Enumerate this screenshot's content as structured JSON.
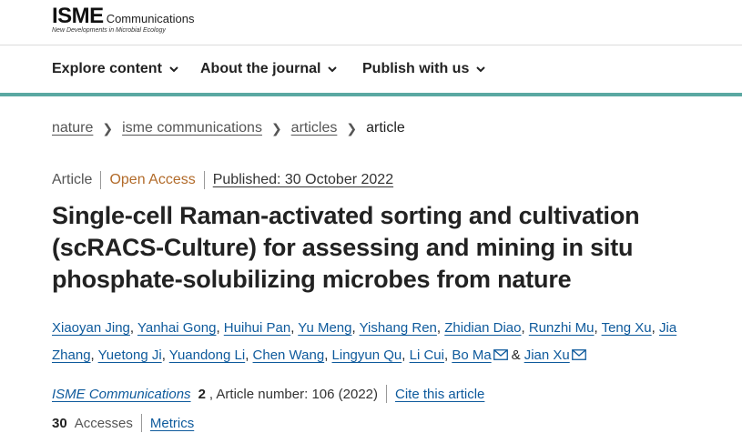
{
  "header": {
    "logo_main": "ISME",
    "logo_sub": "Communications",
    "logo_tagline": "New Developments in Microbial Ecology"
  },
  "nav": {
    "items": [
      {
        "label": "Explore content"
      },
      {
        "label": "About the journal"
      },
      {
        "label": "Publish with us"
      }
    ]
  },
  "breadcrumb": {
    "items": [
      "nature",
      "isme communications",
      "articles"
    ],
    "current": "article"
  },
  "meta": {
    "type": "Article",
    "access": "Open Access",
    "published": "Published: 30 October 2022"
  },
  "title": "Single-cell Raman-activated sorting and cultivation (scRACS-Culture) for assessing and mining in situ phosphate-solubilizing microbes from nature",
  "authors": [
    "Xiaoyan Jing",
    "Yanhai Gong",
    "Huihui Pan",
    "Yu Meng",
    "Yishang Ren",
    "Zhidian Diao",
    "Runzhi Mu",
    "Teng Xu",
    "Jia Zhang",
    "Yuetong Ji",
    "Yuandong Li",
    "Chen Wang",
    "Lingyun Qu",
    "Li Cui",
    "Bo Ma",
    "Jian Xu"
  ],
  "authors_joiner": "&",
  "citation": {
    "journal": "ISME Communications",
    "volume": "2",
    "article_number": ", Article number: 106 (2022)",
    "cite_link": "Cite this article"
  },
  "metrics": {
    "accesses_count": "30",
    "accesses_label": "Accesses",
    "metrics_link": "Metrics"
  },
  "colors": {
    "accent_bar": "#5aa8a2",
    "link": "#0e5a9c",
    "open_access": "#b26b2a"
  }
}
